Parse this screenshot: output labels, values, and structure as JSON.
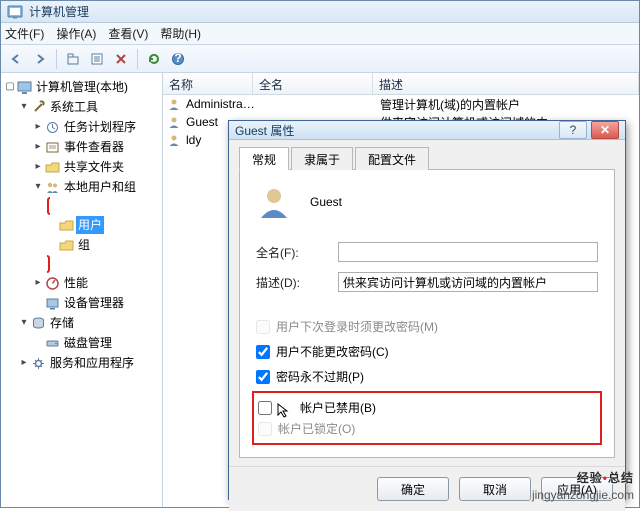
{
  "window": {
    "title": "计算机管理"
  },
  "menubar": {
    "file": "文件(F)",
    "action": "操作(A)",
    "view": "查看(V)",
    "help": "帮助(H)"
  },
  "tree": {
    "root": "计算机管理(本地)",
    "system_tools": "系统工具",
    "task_scheduler": "任务计划程序",
    "event_viewer": "事件查看器",
    "shared_folders": "共享文件夹",
    "local_users_groups": "本地用户和组",
    "users": "用户",
    "groups": "组",
    "performance": "性能",
    "device_manager": "设备管理器",
    "storage": "存储",
    "disk_management": "磁盘管理",
    "services_apps": "服务和应用程序"
  },
  "list": {
    "col_name": "名称",
    "col_fullname": "全名",
    "col_desc": "描述",
    "rows": [
      {
        "name": "Administrat...",
        "fullname": "",
        "desc": "管理计算机(域)的内置帐户"
      },
      {
        "name": "Guest",
        "fullname": "",
        "desc": "供来宾访问计算机或访问域的内"
      },
      {
        "name": "ldy",
        "fullname": "",
        "desc": ""
      }
    ]
  },
  "dialog": {
    "title": "Guest 属性",
    "tabs": {
      "general": "常规",
      "memberof": "隶属于",
      "profile": "配置文件"
    },
    "username": "Guest",
    "fullname_label": "全名(F):",
    "fullname_value": "",
    "desc_label": "描述(D):",
    "desc_value": "供来宾访问计算机或访问域的内置帐户",
    "chk_must_change": "用户下次登录时须更改密码(M)",
    "chk_cannot_change": "用户不能更改密码(C)",
    "chk_never_expire": "密码永不过期(P)",
    "chk_disabled": "帐户已禁用(B)",
    "chk_locked": "帐户已锁定(O)",
    "btn_ok": "确定",
    "btn_cancel": "取消",
    "btn_apply": "应用(A)"
  },
  "watermark": {
    "l1_a": "经验",
    "l1_b": "总结",
    "l2": "jingyanzongjie.com"
  }
}
